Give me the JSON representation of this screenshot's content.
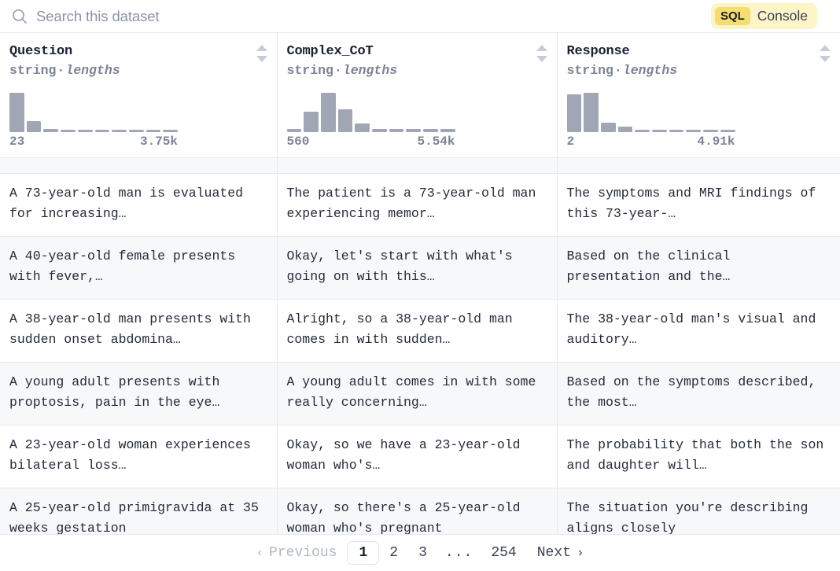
{
  "search": {
    "placeholder": "Search this dataset",
    "value": "",
    "icon": "search-icon"
  },
  "sql_console": {
    "badge": "SQL",
    "label": "Console",
    "badge_color": "#f5dd6e",
    "background_color": "#fdf4c8"
  },
  "columns": [
    {
      "name": "Question",
      "type": "string",
      "separator": "·",
      "stat": "lengths",
      "min_label": "23",
      "max_label": "3.75k",
      "sort_icon": "sort-arrows-icon",
      "histogram": [
        46,
        13,
        4,
        3,
        3,
        3,
        3,
        3,
        3,
        3
      ]
    },
    {
      "name": "Complex_CoT",
      "type": "string",
      "separator": "·",
      "stat": "lengths",
      "min_label": "560",
      "max_label": "5.54k",
      "sort_icon": "sort-arrows-icon",
      "histogram": [
        3,
        22,
        42,
        24,
        9,
        3,
        3,
        3,
        3,
        3
      ]
    },
    {
      "name": "Response",
      "type": "string",
      "separator": "·",
      "stat": "lengths",
      "min_label": "2",
      "max_label": "4.91k",
      "sort_icon": "sort-arrows-icon",
      "histogram": [
        43,
        45,
        11,
        6,
        3,
        3,
        3,
        3,
        3,
        3
      ]
    }
  ],
  "rows": [
    {
      "clipped": "top",
      "Question": "",
      "Complex_CoT": "",
      "Response": ""
    },
    {
      "Question": "A 73-year-old man is evaluated for increasing…",
      "Complex_CoT": "The patient is a 73-year-old man experiencing memor…",
      "Response": "The symptoms and MRI findings of this 73-year-…"
    },
    {
      "Question": "A 40-year-old female presents with fever,…",
      "Complex_CoT": "Okay, let's start with what's going on with this…",
      "Response": "Based on the clinical presentation and the…"
    },
    {
      "Question": "A 38-year-old man presents with sudden onset abdomina…",
      "Complex_CoT": "Alright, so a 38-year-old man comes in with sudden…",
      "Response": "The 38-year-old man's visual and auditory…"
    },
    {
      "Question": "A young adult presents with proptosis, pain in the eye…",
      "Complex_CoT": "A young adult comes in with some really concerning…",
      "Response": "Based on the symptoms described, the most…"
    },
    {
      "Question": "A 23-year-old woman experiences bilateral loss…",
      "Complex_CoT": "Okay, so we have a 23-year-old woman who's…",
      "Response": "The probability that both the son and daughter will…"
    },
    {
      "clipped": "bottom",
      "Question": "A 25-year-old primigravida at 35 weeks gestation",
      "Complex_CoT": "Okay, so there's a 25-year-old woman who's pregnant",
      "Response": "The situation you're describing aligns closely"
    }
  ],
  "pagination": {
    "previous_label": "Previous",
    "previous_icon": "chevron-left-icon",
    "previous_disabled": true,
    "pages": [
      "1",
      "2",
      "3"
    ],
    "ellipsis": "...",
    "last_page": "254",
    "current_page": "1",
    "next_label": "Next",
    "next_icon": "chevron-right-icon"
  }
}
